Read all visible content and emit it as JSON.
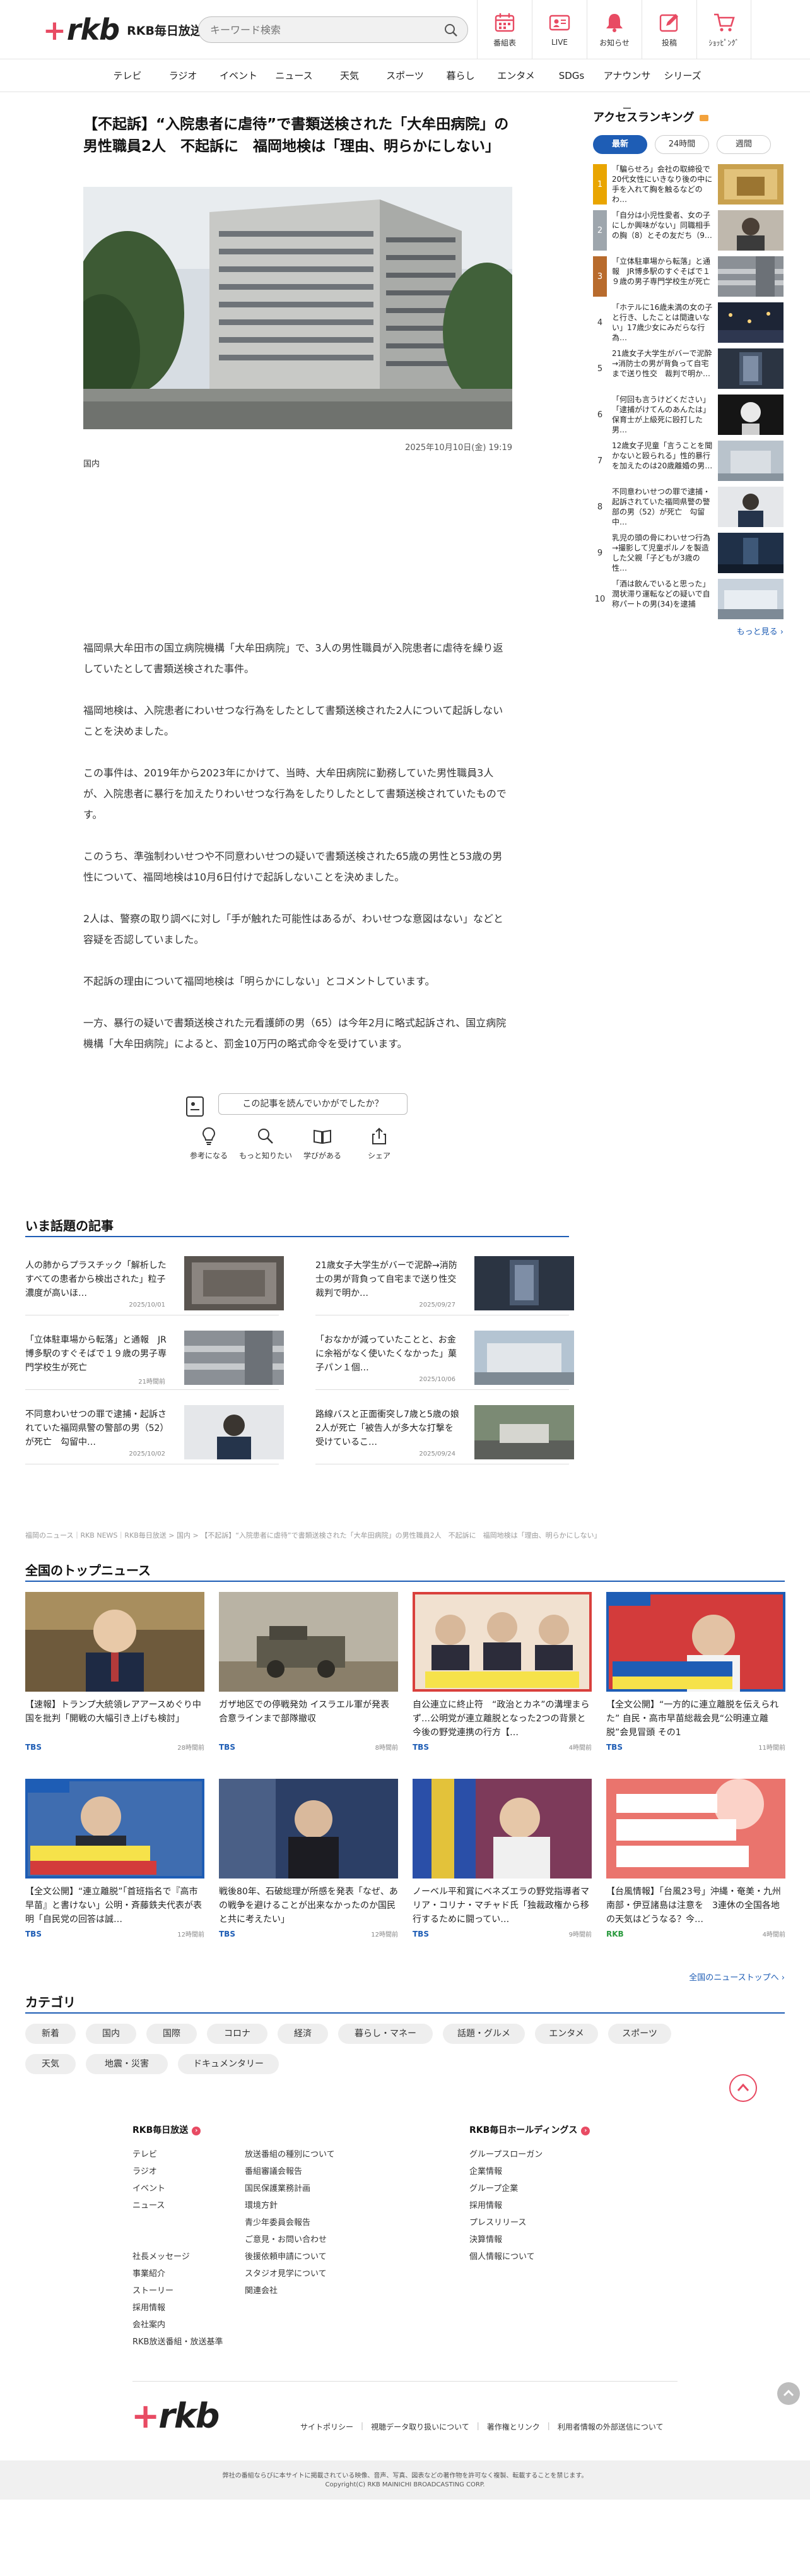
{
  "header": {
    "logo_text": "rkb",
    "station_name": "RKB毎日放送",
    "search_placeholder": "キーワード検索",
    "nav": [
      {
        "label": "番組表",
        "icon": "calendar-icon"
      },
      {
        "label": "LIVE",
        "icon": "live-tv-icon"
      },
      {
        "label": "お知らせ",
        "icon": "bell-icon"
      },
      {
        "label": "投稿",
        "icon": "post-icon"
      },
      {
        "label": "ｼｮｯﾋﾟﾝｸﾞ",
        "icon": "cart-icon"
      }
    ]
  },
  "global_nav": [
    "テレビ",
    "ラジオ",
    "イベント",
    "ニュース",
    "天気",
    "スポーツ",
    "暮らし",
    "エンタメ",
    "SDGs",
    "アナウンサー",
    "シリーズ"
  ],
  "article": {
    "title": "【不起訴】“入院患者に虐待”で書類送検された「大牟田病院」の男性職員2人　不起訴に　福岡地検は「理由、明らかにしない」",
    "date": "2025年10月10日(金) 19:19",
    "category": "国内",
    "paragraphs": [
      "福岡県大牟田市の国立病院機構「大牟田病院」で、3人の男性職員が入院患者に虐待を繰り返していたとして書類送検された事件。",
      "福岡地検は、入院患者にわいせつな行為をしたとして書類送検された2人について起訴しないことを決めました。",
      "この事件は、2019年から2023年にかけて、当時、大牟田病院に勤務していた男性職員3人が、入院患者に暴行を加えたりわいせつな行為をしたりしたとして書類送検されていたものです。",
      "このうち、準強制わいせつや不同意わいせつの疑いで書類送検された65歳の男性と53歳の男性について、福岡地検は10月6日付けで起訴しないことを決めました。",
      "2人は、警察の取り調べに対し「手が触れた可能性はあるが、わいせつな意図はない」などと容疑を否認していました。",
      "不起訴の理由について福岡地検は「明らかにしない」とコメントしています。",
      "一方、暴行の疑いで書類送検された元看護師の男（65）は今年2月に略式起訴され、国立病院機構「大牟田病院」によると、罰金10万円の略式命令を受けています。"
    ],
    "feedback_question": "この記事を読んでいかがでしたか？",
    "feedback_options": [
      {
        "label": "参考になる",
        "icon": "lightbulb-icon"
      },
      {
        "label": "もっと知りたい",
        "icon": "magnifier-icon"
      },
      {
        "label": "学びがある",
        "icon": "book-icon"
      },
      {
        "label": "シェア",
        "icon": "share-icon"
      }
    ]
  },
  "ranking": {
    "heading": "アクセスランキング",
    "tabs": [
      "最新",
      "24時間",
      "週間"
    ],
    "active_tab": "最新",
    "items": [
      {
        "rank": "1",
        "text": "「騙らせろ」会社の取締役で20代女性にいきなり後の中に手を入れて胸を触るなどのわ…"
      },
      {
        "rank": "2",
        "text": "「自分は小児性愛者、女の子にしか興味がない」同職相手の胸（8）とその友だち（9…"
      },
      {
        "rank": "3",
        "text": "「立体駐車場から転落」と通報　JR博多駅のすぐそばで１９歳の男子専門学校生が死亡"
      },
      {
        "rank": "4",
        "text": "「ホテルに16歳未満の女の子と行き、したことは間違いない」17歳少女にみだらな行為…"
      },
      {
        "rank": "5",
        "text": "21歳女子大学生がバーで泥酔→消防士の男が背負って自宅まで送り性交　裁判で明か…"
      },
      {
        "rank": "6",
        "text": "「何回も言うけどください」「逮捕がけてんのあんたは」保育士が上級死に殴打した男…"
      },
      {
        "rank": "7",
        "text": "12歳女子児童「言うことを聞かないと殴られる」性的暴行を加えたのは20歳離婚の男…"
      },
      {
        "rank": "8",
        "text": "不同意わいせつの罪で逮捕・起訴されていた福岡県警の警部の男（52）が死亡　勾留中…"
      },
      {
        "rank": "9",
        "text": "乳児の頭の骨にわいせつ行為→撮影して児童ポルノを製造した父親「子どもが3歳の性…"
      },
      {
        "rank": "10",
        "text": "「酒は飲んでいると思った」潤状滞り運転などの疑いで自称パートの男(34)を逮捕"
      }
    ],
    "more_label": "もっと見る"
  },
  "trending": {
    "heading": "いま話題の記事",
    "items": [
      {
        "title": "人の肺からプラスチック「解析したすべての患者から検出された」粒子濃度が高いほ…",
        "date": "2025/10/01"
      },
      {
        "title": "21歳女子大学生がバーで泥酔→消防士の男が背負って自宅まで送り性交　裁判で明か…",
        "date": "2025/09/27"
      },
      {
        "title": "「立体駐車場から転落」と通報　JR博多駅のすぐそばで１９歳の男子専門学校生が死亡",
        "date": "21時間前"
      },
      {
        "title": "「おなかが減っていたことと、お金に余裕がなく使いたくなかった」菓子パン１個…",
        "date": "2025/10/06"
      },
      {
        "title": "不同意わいせつの罪で逮捕・起訴されていた福岡県警の警部の男（52）が死亡　勾留中…",
        "date": "2025/10/02"
      },
      {
        "title": "路線バスと正面衝突し7歳と5歳の娘2人が死亡「被告人が多大な打撃を受けているこ…",
        "date": "2025/09/24"
      }
    ]
  },
  "breadcrumb": "福岡のニュース｜RKB NEWS｜RKB毎日放送 > 国内 > 【不起訴】“入院患者に虐待”で書類送検された「大牟田病院」の男性職員2人　不起訴に　福岡地検は「理由、明らかにしない」",
  "top_news": {
    "heading": "全国のトップニュース",
    "items": [
      {
        "title": "【速報】トランプ大統領レアアースめぐり中国を批判「開戦の大幅引き上げも検討」",
        "source": "TBS",
        "date": "28時間前"
      },
      {
        "title": "ガザ地区での停戦発効 イスラエル軍が発表　合意ラインまで部隊撤収",
        "source": "TBS",
        "date": "8時間前"
      },
      {
        "title": "自公連立に終止符　“政治とカネ”の溝埋まらず…公明党が連立離脱となった2つの背景と今後の野党連携の行方【…",
        "source": "TBS",
        "date": "4時間前"
      },
      {
        "title": "【全文公開】“一方的に連立離脱を伝えられた” 自民・高市早苗総裁会見“公明連立離脱”会見冒頭 その1",
        "source": "TBS",
        "date": "11時間前"
      },
      {
        "title": "【全文公開】“連立離脱”「首班指名で『高市早苗』と書けない」公明・斉藤鉄夫代表が表明「自民党の回答は誠…",
        "source": "TBS",
        "date": "12時間前"
      },
      {
        "title": "戦後80年、石破総理が所感を発表「なぜ、あの戦争を避けることが出来なかったのか国民と共に考えたい」",
        "source": "TBS",
        "date": "12時間前"
      },
      {
        "title": "ノーベル平和賞にベネズエラの野党指導者マリア・コリナ・マチャド氏「独裁政権から移行するために闘ってい…",
        "source": "TBS",
        "date": "9時間前"
      },
      {
        "title": "【台風情報】「台風23号」沖縄・奄美・九州南部・伊豆諸島は注意を　3連休の全国各地の天気はどうなる？今…",
        "source": "RKB",
        "date": "4時間前"
      }
    ],
    "more_label": "全国のニューストップへ"
  },
  "categories": {
    "heading": "カテゴリ",
    "row1": [
      "新着",
      "国内",
      "国際",
      "コロナ",
      "経済",
      "暮らし・マネー",
      "話題・グルメ",
      "エンタメ",
      "スポーツ"
    ],
    "row2": [
      "天気",
      "地震・災害",
      "ドキュメンタリー"
    ]
  },
  "footer": {
    "col1_heading": "RKB毎日放送",
    "col1_left": [
      "テレビ",
      "ラジオ",
      "イベント",
      "ニュース"
    ],
    "col1_left2": [
      "社長メッセージ",
      "事業紹介",
      "ストーリー",
      "採用情報",
      "会社案内",
      "RKB放送番組・放送基準"
    ],
    "col1_right": [
      "放送番組の種別について",
      "番組審議会報告",
      "国民保護業務計画",
      "環境方針",
      "青少年委員会報告",
      "ご意見・お問い合わせ",
      "後援依頼申請について",
      "スタジオ見学について",
      "関連会社"
    ],
    "col2_heading": "RKB毎日ホールディングス",
    "col2_list": [
      "グループスローガン",
      "企業情報",
      "グループ企業",
      "採用情報",
      "プレスリリース",
      "決算情報",
      "個人情報について"
    ],
    "logo_text": "rkb",
    "links": [
      "サイトポリシー",
      "視聴データ取り扱いについて",
      "著作権とリンク",
      "利用者情報の外部送信について"
    ],
    "copyright1": "弊社の番組ならびに本サイトに掲載されている映像、音声、写真、図表などの著作物を許可なく複製、転載することを禁じます。",
    "copyright2": "Copyright(C) RKB MAINICHI BROADCASTING CORP."
  },
  "colors": {
    "accent": "#1e5db5",
    "brand": "#e84b63",
    "rank_gold": "#e9a500",
    "rank_silver": "#9ea6ad",
    "rank_bronze": "#b86b2d"
  }
}
